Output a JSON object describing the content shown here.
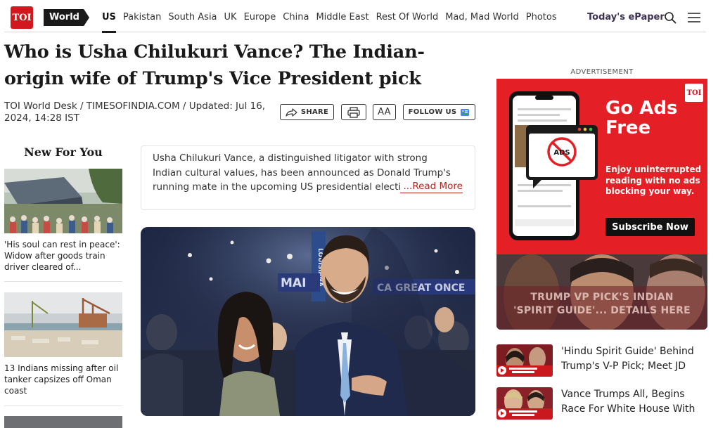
{
  "nav": {
    "logo": "TOI",
    "section": "World",
    "links": [
      "US",
      "Pakistan",
      "South Asia",
      "UK",
      "Europe",
      "China",
      "Middle East",
      "Rest Of World",
      "Mad, Mad World",
      "Photos"
    ],
    "epaper": "Today's ePaper",
    "colors": {
      "brand": "#d0181e",
      "section_tag": "#1a1a1a"
    }
  },
  "article": {
    "headline": "Who is Usha Chilukuri Vance? The Indian-origin wife of Trump's Vice President pick",
    "byline": "TOI World Desk / TIMESOFINDIA.COM / Updated: Jul 16, 2024, 14:28 IST",
    "actions": {
      "share": "SHARE",
      "font_size": "AA",
      "follow": "FOLLOW US"
    },
    "summary": "Usha Chilukuri Vance, a distinguished litigator with strong Indian cultural values, has been announced as Donald Trump's running mate in the upcoming US presidential election.",
    "read_more": "Read More",
    "read_more_prefix": "..."
  },
  "new_for_you": {
    "title": "New For You",
    "items": [
      {
        "text": "'His soul can rest in peace': Widow after goods train driver cleared of..."
      },
      {
        "text": "13 Indians missing after oil tanker capsizes off Oman coast"
      }
    ]
  },
  "ad": {
    "label": "ADVERTISEMENT",
    "logo": "TOI",
    "headline": "Go Ads Free",
    "sub": "Enjoy uninterrupted reading with no ads blocking your way.",
    "button": "Subscribe Now",
    "phone_badge": "ADS",
    "color": "#e41f26"
  },
  "vp_banner": {
    "line1": "TRUMP VP PICK'S INDIAN",
    "line2": "'SPIRIT GUIDE'... DETAILS HERE"
  },
  "related": [
    {
      "title": "'Hindu Spirit Guide' Behind Trump's V-P Pick; Meet JD"
    },
    {
      "title": "Vance Trumps All, Begins Race For White House With"
    }
  ]
}
